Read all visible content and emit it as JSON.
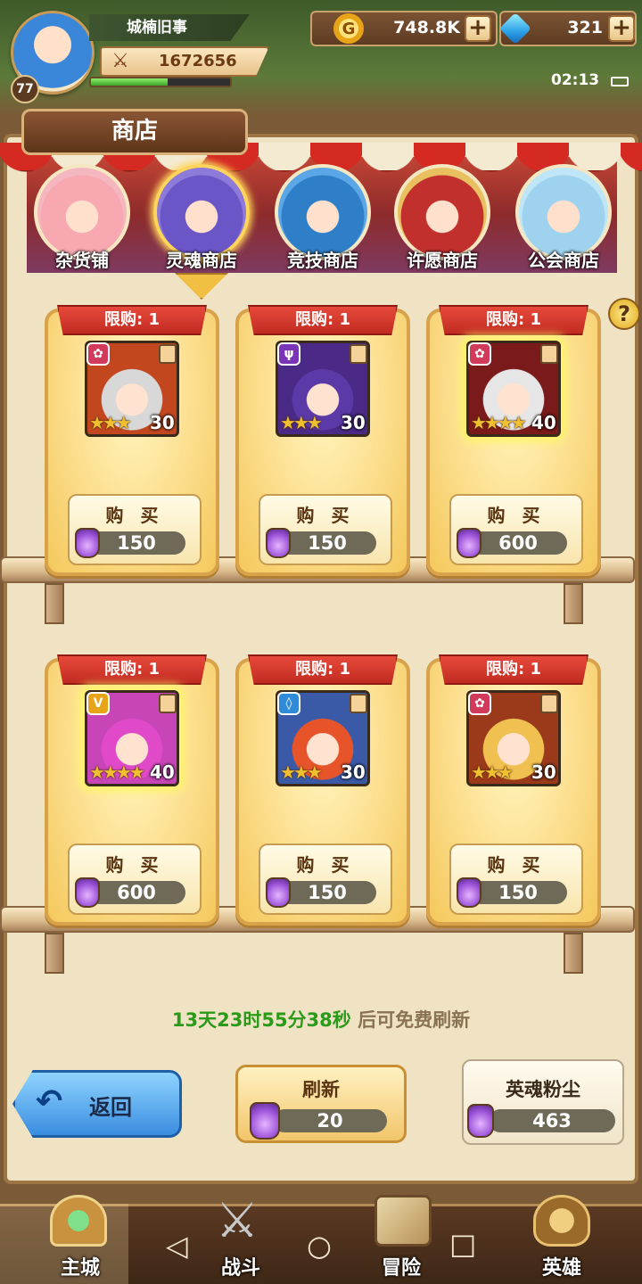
{
  "player": {
    "name": "城楠旧事",
    "level": "77",
    "power": "1672656",
    "exp_fraction": 0.55
  },
  "resources": {
    "gold": "748.8K",
    "diamonds": "321"
  },
  "status": {
    "time": "02:13"
  },
  "shop": {
    "title": "商店",
    "tabs": [
      {
        "label": "杂货铺",
        "color": "#f4b7c0",
        "hair": "#f7a8b0"
      },
      {
        "label": "灵魂商店",
        "color": "#8e7ad8",
        "hair": "#6b56c8"
      },
      {
        "label": "竞技商店",
        "color": "#5aa6e6",
        "hair": "#2f7fc8"
      },
      {
        "label": "许愿商店",
        "color": "#e8c060",
        "hair": "#c2302e"
      },
      {
        "label": "公会商店",
        "color": "#bfe6f6",
        "hair": "#9ed2ee"
      }
    ],
    "selected_tab": "灵魂商店"
  },
  "items": [
    {
      "limit": "限购: 1",
      "level": "30",
      "stars": "★★★",
      "buy": "购 买",
      "price": "150",
      "element": "✿",
      "elem_color": "#d23a5c",
      "art": "#c2471f",
      "hair": "#d8d8d8"
    },
    {
      "limit": "限购: 1",
      "level": "30",
      "stars": "★★★",
      "buy": "购 买",
      "price": "150",
      "element": "ψ",
      "elem_color": "#7a34b8",
      "art": "#4a2a86",
      "hair": "#5b3aa8"
    },
    {
      "limit": "限购: 1",
      "level": "40",
      "stars": "★★★★",
      "buy": "购 买",
      "price": "600",
      "element": "✿",
      "elem_color": "#d23a5c",
      "art": "#7a1a1a",
      "hair": "#e6e6e6"
    },
    {
      "limit": "限购: 1",
      "level": "40",
      "stars": "★★★★",
      "buy": "购 买",
      "price": "600",
      "element": "V",
      "elem_color": "#e8a418",
      "art": "#c845b8",
      "hair": "#e04ac8"
    },
    {
      "limit": "限购: 1",
      "level": "30",
      "stars": "★★★",
      "buy": "购 买",
      "price": "150",
      "element": "◊",
      "elem_color": "#2f8ad8",
      "art": "#3a5aa8",
      "hair": "#e8542a"
    },
    {
      "limit": "限购: 1",
      "level": "30",
      "stars": "★★★",
      "buy": "购 买",
      "price": "150",
      "element": "✿",
      "elem_color": "#d23a5c",
      "art": "#9a3a1a",
      "hair": "#f0c050"
    }
  ],
  "refresh_timer": {
    "time": "13天23时55分38秒",
    "suffix": "后可免费刷新"
  },
  "back_label": "返回",
  "refresh": {
    "label": "刷新",
    "cost": "20"
  },
  "hero_dust": {
    "label": "英魂粉尘",
    "value": "463"
  },
  "nav": [
    "主城",
    "战斗",
    "冒险",
    "英雄"
  ]
}
